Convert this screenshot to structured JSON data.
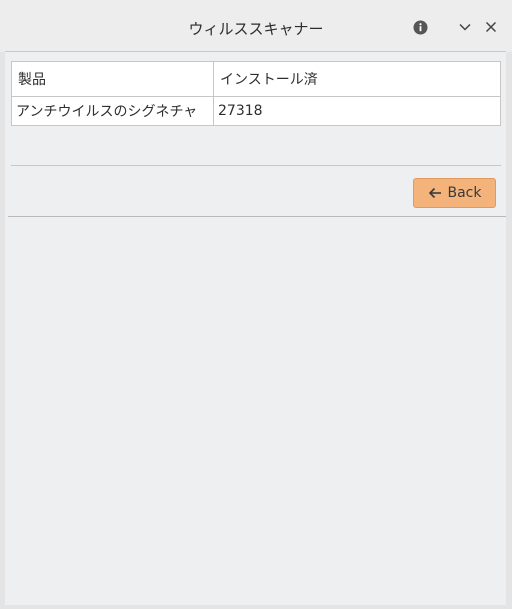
{
  "window": {
    "title": "ウィルススキャナー"
  },
  "titlebar": {
    "info_icon": "info-icon",
    "minimize_icon": "chevron-down-icon",
    "close_icon": "close-icon"
  },
  "table": {
    "headers": [
      "製品",
      "インストール済"
    ],
    "rows": [
      [
        "アンチウイルスのシグネチャ",
        "27318"
      ]
    ]
  },
  "actions": {
    "back_label": "Back",
    "back_icon": "arrow-left-icon"
  },
  "colors": {
    "accent": "#f4b37a"
  }
}
